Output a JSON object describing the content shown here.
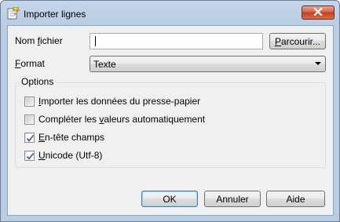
{
  "window": {
    "title": "Importer lignes"
  },
  "fields": {
    "filename_label_pre": "Nom ",
    "filename_label_ul": "f",
    "filename_label_post": "ichier",
    "filename_value": "",
    "browse_label_ul": "P",
    "browse_label_post": "arcourir...",
    "format_label_ul": "F",
    "format_label_post": "ormat",
    "format_value": "Texte"
  },
  "options": {
    "title": "Options",
    "items": [
      {
        "ul": "I",
        "rest": "mporter les données du presse-papier",
        "checked": false
      },
      {
        "pre": "Compléter les ",
        "ul": "v",
        "rest": "aleurs automatiquement",
        "checked": false
      },
      {
        "ul": "E",
        "rest": "n-tête champs",
        "checked": true
      },
      {
        "ul": "U",
        "rest": "nicode (Utf-8)",
        "checked": true
      }
    ]
  },
  "buttons": {
    "ok": "OK",
    "cancel": "Annuler",
    "help": "Aide"
  },
  "icons": {
    "title_icon": "import-lines-icon",
    "close_icon": "close-icon",
    "dropdown_icon": "chevron-down-icon",
    "check_icon": "checkmark-icon"
  }
}
